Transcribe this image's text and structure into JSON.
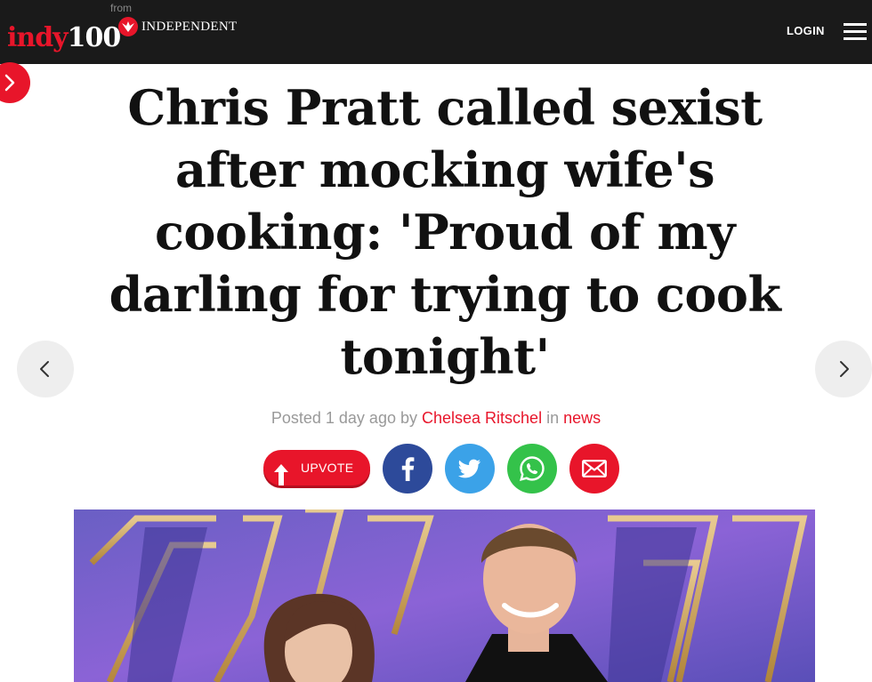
{
  "header": {
    "logo_part1": "indy",
    "logo_part2": "100",
    "logo_from": "from",
    "logo_publisher": "INDEPENDENT",
    "login_label": "LOGIN"
  },
  "article": {
    "headline": "Chris Pratt called sexist after mocking wife's cooking: 'Proud of my darling for trying to cook tonight'",
    "byline_prefix": "Posted 1 day ago by",
    "author": "Chelsea Ritschel",
    "byline_in": "in",
    "category": "news"
  },
  "actions": {
    "upvote_label": "UPVOTE"
  },
  "icons": {
    "side_tab": "chevron-right-icon",
    "nav_prev": "chevron-left-icon",
    "nav_next": "chevron-right-icon",
    "facebook": "facebook-icon",
    "twitter": "twitter-icon",
    "whatsapp": "whatsapp-icon",
    "email": "email-icon"
  },
  "colors": {
    "brand_red": "#e8152a",
    "header_bg": "#1a1a1a",
    "facebook": "#2d4a9a",
    "twitter": "#3ba2e8",
    "whatsapp": "#34c24a",
    "email": "#e8152a"
  }
}
